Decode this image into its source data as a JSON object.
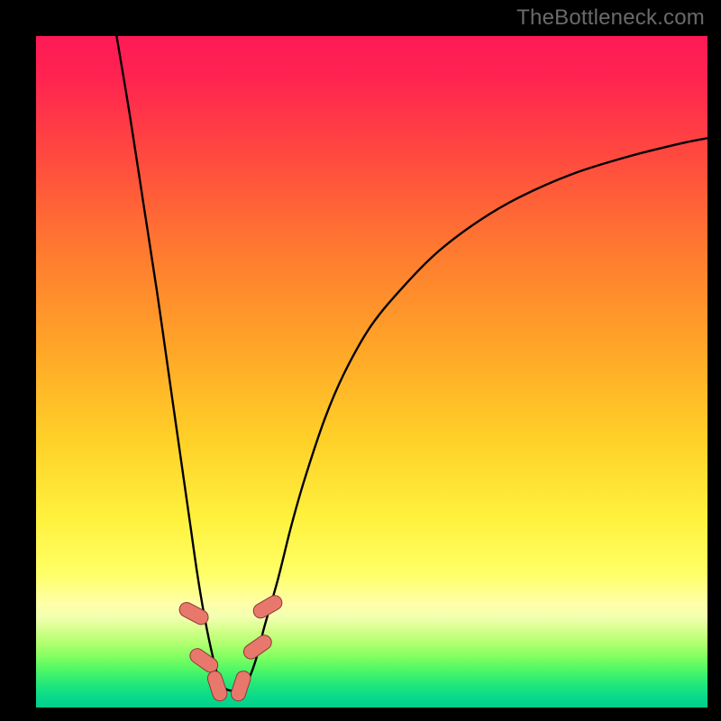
{
  "watermark": "TheBottleneck.com",
  "colors": {
    "black": "#000000",
    "curve": "#000000",
    "marker_fill": "#e8786c",
    "marker_stroke": "#8b3a33",
    "grad_stops": [
      {
        "offset": 0.0,
        "color": "#ff1a55"
      },
      {
        "offset": 0.06,
        "color": "#ff2351"
      },
      {
        "offset": 0.18,
        "color": "#ff4a3f"
      },
      {
        "offset": 0.32,
        "color": "#ff7a30"
      },
      {
        "offset": 0.46,
        "color": "#ffa428"
      },
      {
        "offset": 0.6,
        "color": "#ffd028"
      },
      {
        "offset": 0.72,
        "color": "#fff23e"
      },
      {
        "offset": 0.8,
        "color": "#ffff66"
      },
      {
        "offset": 0.845,
        "color": "#ffffa8"
      },
      {
        "offset": 0.865,
        "color": "#f2ffb0"
      },
      {
        "offset": 0.885,
        "color": "#d4ff8a"
      },
      {
        "offset": 0.905,
        "color": "#b0ff70"
      },
      {
        "offset": 0.925,
        "color": "#80ff60"
      },
      {
        "offset": 0.945,
        "color": "#4cf766"
      },
      {
        "offset": 0.965,
        "color": "#22e87a"
      },
      {
        "offset": 0.985,
        "color": "#08d98a"
      },
      {
        "offset": 1.0,
        "color": "#00cf8e"
      }
    ]
  },
  "chart_data": {
    "type": "line",
    "title": "",
    "xlabel": "",
    "ylabel": "",
    "xlim": [
      0,
      100
    ],
    "ylim": [
      0,
      100
    ],
    "grid": false,
    "note": "Axes are unlabeled; values are estimated from pixel positions as 0–100 percent of the plot area. y=0 at bottom.",
    "series": [
      {
        "name": "bottleneck-curve",
        "x": [
          12,
          14,
          16,
          18,
          20,
          21,
          22,
          23,
          24,
          25,
          26,
          27,
          28,
          29,
          30,
          31,
          32,
          33,
          34,
          36,
          38,
          40,
          43,
          46,
          50,
          55,
          60,
          66,
          72,
          80,
          88,
          96,
          100
        ],
        "y": [
          100,
          88,
          75,
          62,
          48,
          41,
          34,
          27,
          20,
          14,
          9,
          5,
          3,
          2.5,
          2.5,
          3,
          5,
          8,
          12,
          19,
          27,
          34,
          43,
          50,
          57,
          63,
          68,
          72.5,
          76,
          79.5,
          82,
          84,
          84.8
        ]
      }
    ],
    "markers": [
      {
        "x": 23.5,
        "y": 14,
        "angle": -62
      },
      {
        "x": 25.0,
        "y": 7,
        "angle": -55
      },
      {
        "x": 27.0,
        "y": 3.2,
        "angle": -18
      },
      {
        "x": 30.5,
        "y": 3.2,
        "angle": 18
      },
      {
        "x": 33.0,
        "y": 9,
        "angle": 55
      },
      {
        "x": 34.5,
        "y": 15,
        "angle": 60
      }
    ]
  }
}
